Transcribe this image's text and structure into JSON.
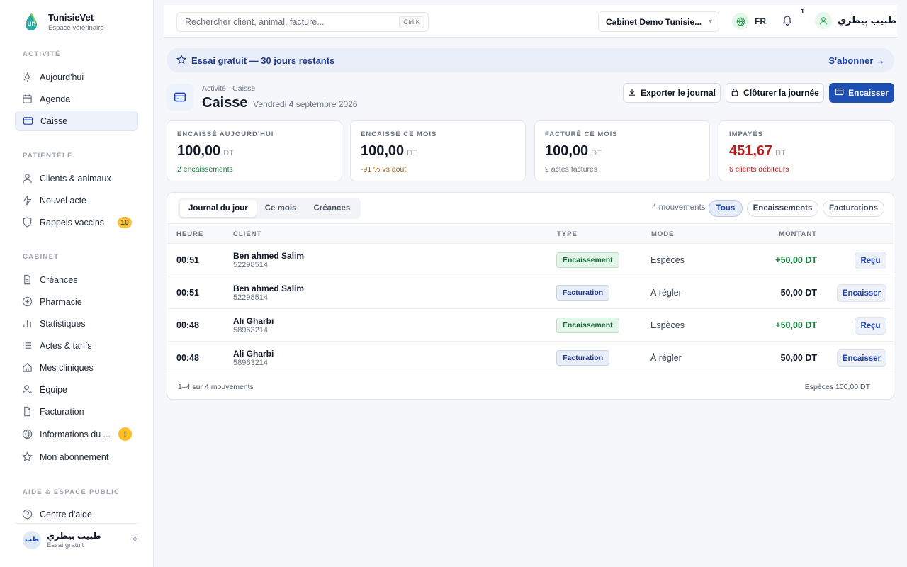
{
  "brand": {
    "name": "TunisieVet",
    "subtitle": "Espace vétérinaire",
    "logo_text": "Tun"
  },
  "sidebar": {
    "sections": [
      {
        "label": "ACTIVITÉ"
      },
      {
        "label": "PATIENTÈLE"
      },
      {
        "label": "CABINET"
      },
      {
        "label": "AIDE & ESPACE PUBLIC"
      }
    ],
    "items": [
      {
        "label": "Aujourd'hui",
        "icon": "sun-icon"
      },
      {
        "label": "Agenda",
        "icon": "calendar-icon"
      },
      {
        "label": "Caisse",
        "icon": "card-icon",
        "active": true
      },
      {
        "label": "Clients & animaux",
        "icon": "user-icon"
      },
      {
        "label": "Nouvel acte",
        "icon": "bolt-icon"
      },
      {
        "label": "Rappels vaccins",
        "icon": "shield-icon",
        "badge": "10"
      },
      {
        "label": "Créances",
        "icon": "document-icon"
      },
      {
        "label": "Pharmacie",
        "icon": "plus-circle-icon"
      },
      {
        "label": "Statistiques",
        "icon": "bar-chart-icon"
      },
      {
        "label": "Actes & tarifs",
        "icon": "list-icon"
      },
      {
        "label": "Mes cliniques",
        "icon": "home-icon"
      },
      {
        "label": "Équipe",
        "icon": "user-plus-icon"
      },
      {
        "label": "Facturation",
        "icon": "file-icon"
      },
      {
        "label": "Informations du ...",
        "icon": "globe-icon",
        "badge": "!"
      },
      {
        "label": "Mon abonnement",
        "icon": "star-icon"
      },
      {
        "label": "Centre d'aide",
        "icon": "help-icon"
      }
    ],
    "user": {
      "initials": "طب",
      "name": "طبيب بيطري",
      "plan": "Essai gratuit"
    }
  },
  "topbar": {
    "search_placeholder": "Rechercher client, animal, facture...",
    "shortcut": "Ctrl K",
    "clinic": "Cabinet Demo Tunisie...",
    "lang": "FR",
    "notifications": "1",
    "user_name": "طبيب بيطري"
  },
  "trial": {
    "text": "Essai gratuit — 30 jours restants",
    "cta": "S'abonner →"
  },
  "header": {
    "breadcrumb": "Activité · Caisse",
    "title": "Caisse",
    "date": "Vendredi 4 septembre 2026",
    "buttons": {
      "export": "Exporter le journal",
      "close": "Clôturer la journée",
      "cash": "Encaisser"
    }
  },
  "stats": [
    {
      "label": "ENCAISSÉ AUJOURD'HUI",
      "value": "100,00",
      "unit": "DT",
      "note": "2 encaissements",
      "note_color": "#15803d"
    },
    {
      "label": "ENCAISSÉ CE MOIS",
      "value": "100,00",
      "unit": "DT",
      "note": "-91 % vs août",
      "note_color": "#a16207"
    },
    {
      "label": "FACTURÉ CE MOIS",
      "value": "100,00",
      "unit": "DT",
      "note": "2 actes facturés",
      "note_color": "#6b7280"
    },
    {
      "label": "IMPAYÉS",
      "value": "451,67",
      "unit": "DT",
      "note": "6 clients débiteurs",
      "note_color": "#b91c1c"
    }
  ],
  "journal": {
    "tabs": [
      "Journal du jour",
      "Ce mois",
      "Créances"
    ],
    "movements_count": "4 mouvements",
    "filters": [
      "Tous",
      "Encaissements",
      "Facturations"
    ],
    "columns": [
      "HEURE",
      "CLIENT",
      "TYPE",
      "MODE",
      "MONTANT"
    ],
    "rows": [
      {
        "time": "00:51",
        "client": "Ben ahmed Salim",
        "phone": "52298514",
        "type": "Encaissement",
        "mode": "Espèces",
        "amount": "+50,00 DT",
        "action": "Reçu"
      },
      {
        "time": "00:51",
        "client": "Ben ahmed Salim",
        "phone": "52298514",
        "type": "Facturation",
        "mode": "À régler",
        "amount": "50,00 DT",
        "action": "Encaisser"
      },
      {
        "time": "00:48",
        "client": "Ali Gharbi",
        "phone": "58963214",
        "type": "Encaissement",
        "mode": "Espèces",
        "amount": "+50,00 DT",
        "action": "Reçu"
      },
      {
        "time": "00:48",
        "client": "Ali Gharbi",
        "phone": "58963214",
        "type": "Facturation",
        "mode": "À régler",
        "amount": "50,00 DT",
        "action": "Encaisser"
      }
    ],
    "footer_left": "1–4 sur 4 mouvements",
    "footer_right": "Espèces 100,00 DT"
  },
  "colors": {
    "primary": "#1e4fb3",
    "success": "#15803d",
    "danger": "#b91c1c",
    "warning": "#f6c343"
  }
}
